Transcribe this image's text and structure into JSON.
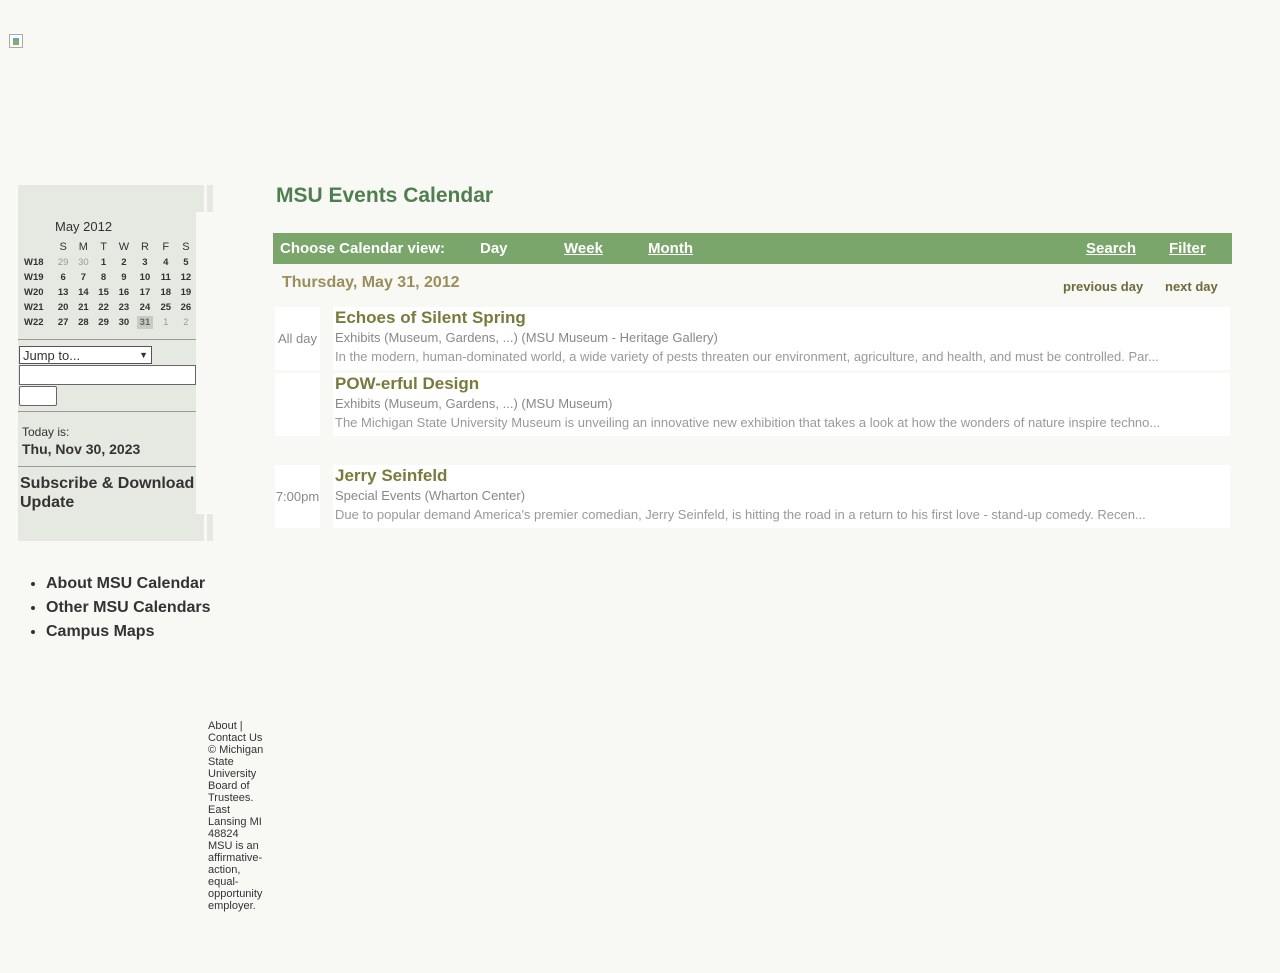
{
  "header": {
    "logo_alt_icon": "broken-image-icon"
  },
  "calendar_mini": {
    "title": "May 2012",
    "weekdays": [
      "S",
      "M",
      "T",
      "W",
      "R",
      "F",
      "S"
    ],
    "weeks": [
      {
        "label": "W18",
        "days": [
          "29",
          "30",
          "1",
          "2",
          "3",
          "4",
          "5"
        ]
      },
      {
        "label": "W19",
        "days": [
          "6",
          "7",
          "8",
          "9",
          "10",
          "11",
          "12"
        ]
      },
      {
        "label": "W20",
        "days": [
          "13",
          "14",
          "15",
          "16",
          "17",
          "18",
          "19"
        ]
      },
      {
        "label": "W21",
        "days": [
          "20",
          "21",
          "22",
          "23",
          "24",
          "25",
          "26"
        ]
      },
      {
        "label": "W22",
        "days": [
          "27",
          "28",
          "29",
          "30",
          "31",
          "1",
          "2"
        ]
      }
    ]
  },
  "sidebar": {
    "jump_label": "Jump to...",
    "today_label": "Today is:",
    "today_value": "Thu, Nov 30, 2023",
    "subscribe": "Subscribe & Download",
    "update": "Update",
    "links": [
      "About MSU Calendar",
      "Other MSU Calendars",
      "Campus Maps"
    ]
  },
  "main": {
    "title": "MSU Events Calendar",
    "nav": {
      "choose": "Choose Calendar view:",
      "day": "Day",
      "week": "Week",
      "month": "Month",
      "search": "Search",
      "filter": "Filter"
    },
    "date": "Thursday, May 31, 2012",
    "previous_day": "previous day",
    "next_day": "next day",
    "events": [
      {
        "time": "All day",
        "title": "Echoes of Silent Spring",
        "category": "Exhibits (Museum, Gardens, ...) (MSU Museum - Heritage Gallery)",
        "description": "In the modern, human-dominated world, a wide variety of pests threaten our environment, agriculture, and health, and must be controlled. Par..."
      },
      {
        "time": "",
        "title": "POW-erful Design",
        "category": "Exhibits (Museum, Gardens, ...) (MSU Museum)",
        "description": "The Michigan State University Museum is unveiling an innovative new exhibition that takes a look at how the wonders of nature inspire techno..."
      },
      {
        "time": "7:00pm",
        "title": "Jerry Seinfeld",
        "category": "Special Events (Wharton Center)",
        "description": "Due to popular demand America's premier comedian, Jerry Seinfeld, is hitting the road in a return to his first love - stand-up comedy. Recen..."
      }
    ]
  },
  "footer": {
    "text": "About | Contact Us © Michigan State University Board of Trustees. East Lansing MI 48824 MSU is an affirmative-action, equal-opportunity employer."
  }
}
